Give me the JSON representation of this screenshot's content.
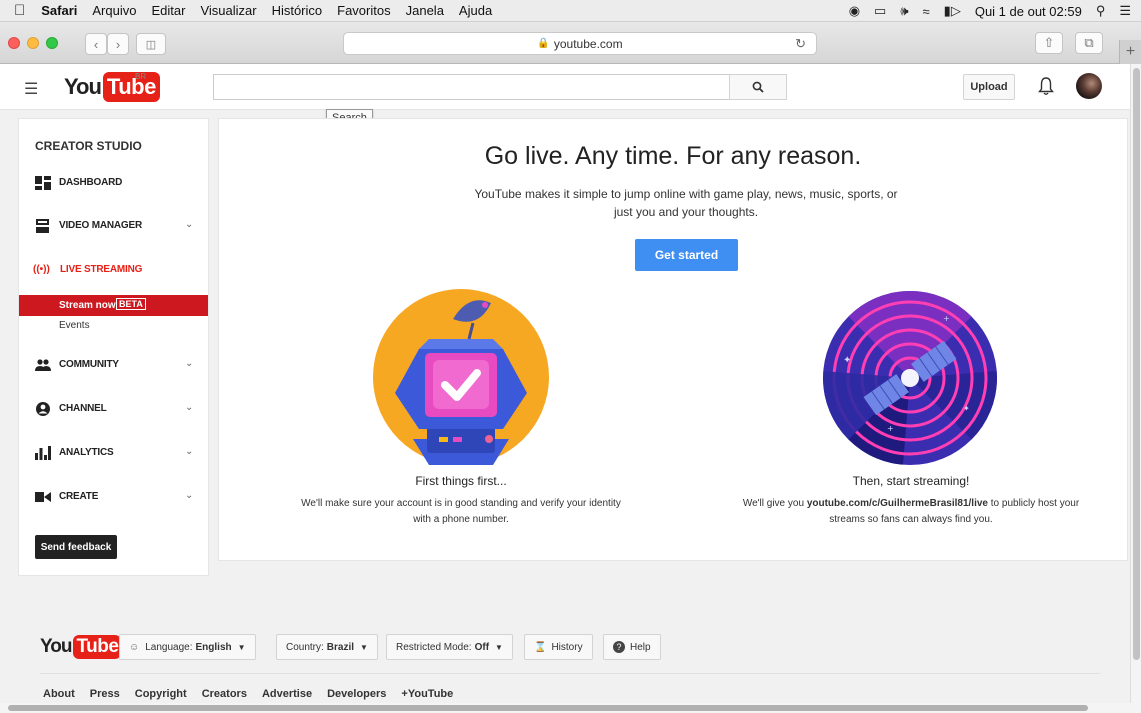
{
  "menubar": {
    "app": "Safari",
    "items": [
      "Arquivo",
      "Editar",
      "Visualizar",
      "Histórico",
      "Favoritos",
      "Janela",
      "Ajuda"
    ],
    "datetime": "Qui 1 de out  02:59"
  },
  "browser": {
    "address": "youtube.com"
  },
  "header": {
    "logo_you": "You",
    "logo_tube": "Tube",
    "country": "BR",
    "search_tooltip": "Search",
    "upload_label": "Upload"
  },
  "sidebar": {
    "title": "CREATOR STUDIO",
    "dashboard": "DASHBOARD",
    "video_manager": "VIDEO MANAGER",
    "live_streaming": "LIVE STREAMING",
    "stream_now": "Stream now",
    "beta": "BETA",
    "events": "Events",
    "community": "COMMUNITY",
    "channel": "CHANNEL",
    "analytics": "ANALYTICS",
    "create": "CREATE",
    "feedback": "Send feedback"
  },
  "main": {
    "headline": "Go live. Any time. For any reason.",
    "subtitle": "YouTube makes it simple to jump online with game play, news, music, sports, or just you and your thoughts.",
    "cta": "Get started",
    "left_caption": "First things first...",
    "left_desc": "We'll make sure your account is in good standing and verify your identity with a phone number.",
    "right_caption": "Then, start streaming!",
    "right_desc_pre": "We'll give you ",
    "right_desc_link": "youtube.com/c/GuilhermeBrasil81/live",
    "right_desc_post": " to publicly host your streams so fans can always find you."
  },
  "footer": {
    "language_label": "Language:",
    "language_value": "English",
    "country_label": "Country:",
    "country_value": "Brazil",
    "restricted_label": "Restricted Mode:",
    "restricted_value": "Off",
    "history": "History",
    "help": "Help",
    "links": [
      "About",
      "Press",
      "Copyright",
      "Creators",
      "Advertise",
      "Developers",
      "+YouTube"
    ]
  },
  "colors": {
    "youtube_red": "#e62117",
    "active_red": "#cc181e",
    "cta_blue": "#3f8ef2"
  }
}
